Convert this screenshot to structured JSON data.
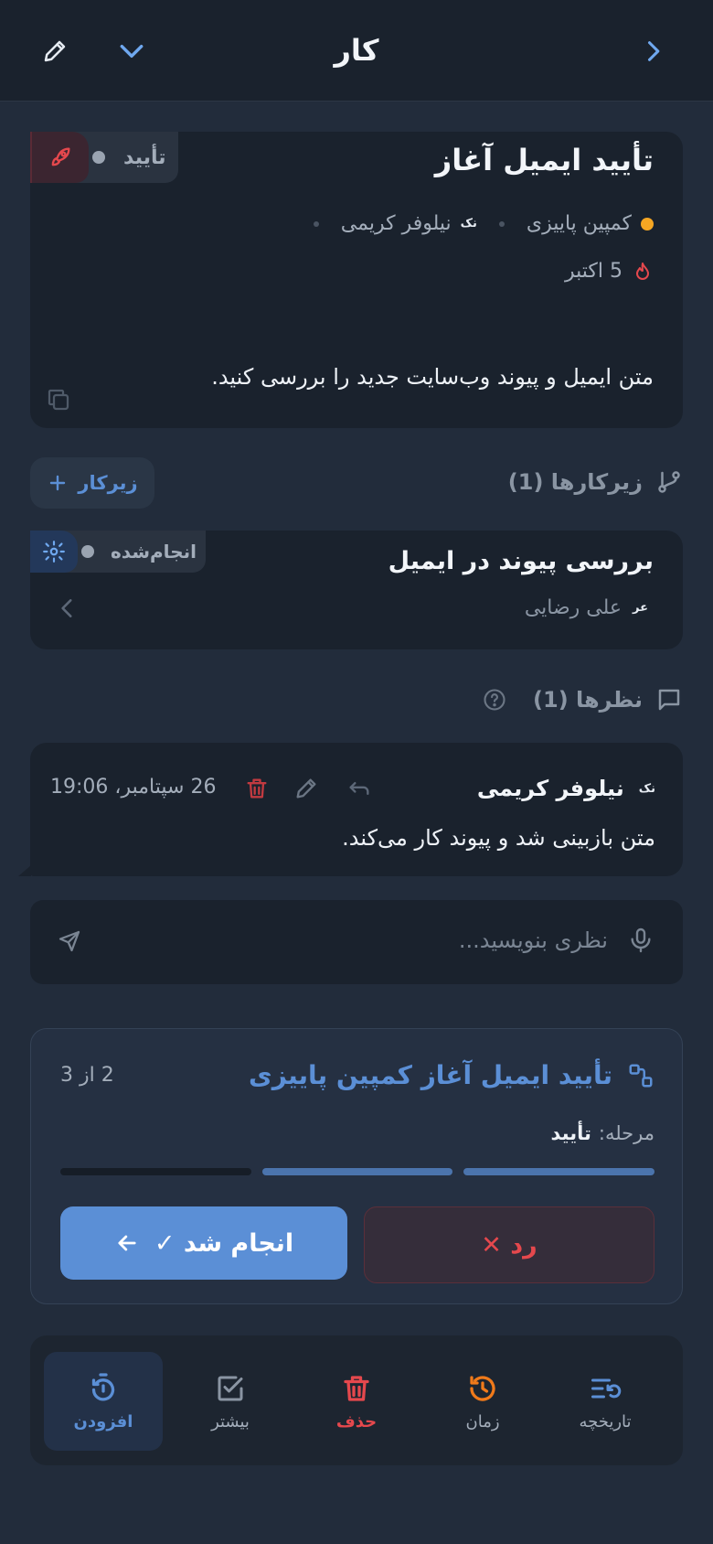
{
  "header": {
    "title": "کار",
    "back_icon": "chevron-right-icon",
    "expand_icon": "chevron-down-icon",
    "edit_icon": "pencil-icon"
  },
  "task": {
    "title": "تأیید ایمیل آغاز",
    "status": "تأیید",
    "status_icon": "rocket-icon",
    "project": "کمپین پاییزی",
    "project_color": "#f5a623",
    "assignee_initials": "نک",
    "assignee": "نیلوفر کریمی",
    "due": "5 اکتبر",
    "due_icon": "fire-icon",
    "description": "متن ایمیل و پیوند وب‌سایت جدید را بررسی کنید.",
    "copy_icon": "copy-icon"
  },
  "subtasks": {
    "heading": "زیرکارها (1)",
    "add_label": "زیرکار",
    "items": [
      {
        "title": "بررسی پیوند در ایمیل",
        "status": "انجام‌شده",
        "assignee_initials": "عر",
        "assignee": "علی رضایی"
      }
    ]
  },
  "comments": {
    "heading": "نظرها (1)",
    "items": [
      {
        "author_initials": "نک",
        "author": "نیلوفر کریمی",
        "timestamp": "26 سپتامبر، 19:06",
        "text": "متن بازبینی شد و پیوند کار می‌کند."
      }
    ],
    "input_placeholder": "نظری بنویسید..."
  },
  "workflow": {
    "title": "تأیید ایمیل آغاز کمپین پاییزی",
    "counter": "2 از 3",
    "stage_label": "مرحله:",
    "stage_value": "تأیید",
    "steps_done": 2,
    "steps_total": 3,
    "reject_label": "رد ✕",
    "done_label": "انجام شد ✓"
  },
  "bottom_nav": [
    {
      "label": "تاریخچه",
      "icon": "history-list-icon"
    },
    {
      "label": "زمان",
      "icon": "clock-history-icon"
    },
    {
      "label": "حذف",
      "icon": "trash-icon"
    },
    {
      "label": "بیشتر",
      "icon": "checkbox-icon"
    },
    {
      "label": "افزودن",
      "icon": "timer-add-icon"
    }
  ],
  "colors": {
    "background": "#222c3b",
    "card": "#1a222d",
    "accent_blue": "#5b8fd6",
    "danger_red": "#e5484d",
    "orange": "#f07a1a"
  }
}
